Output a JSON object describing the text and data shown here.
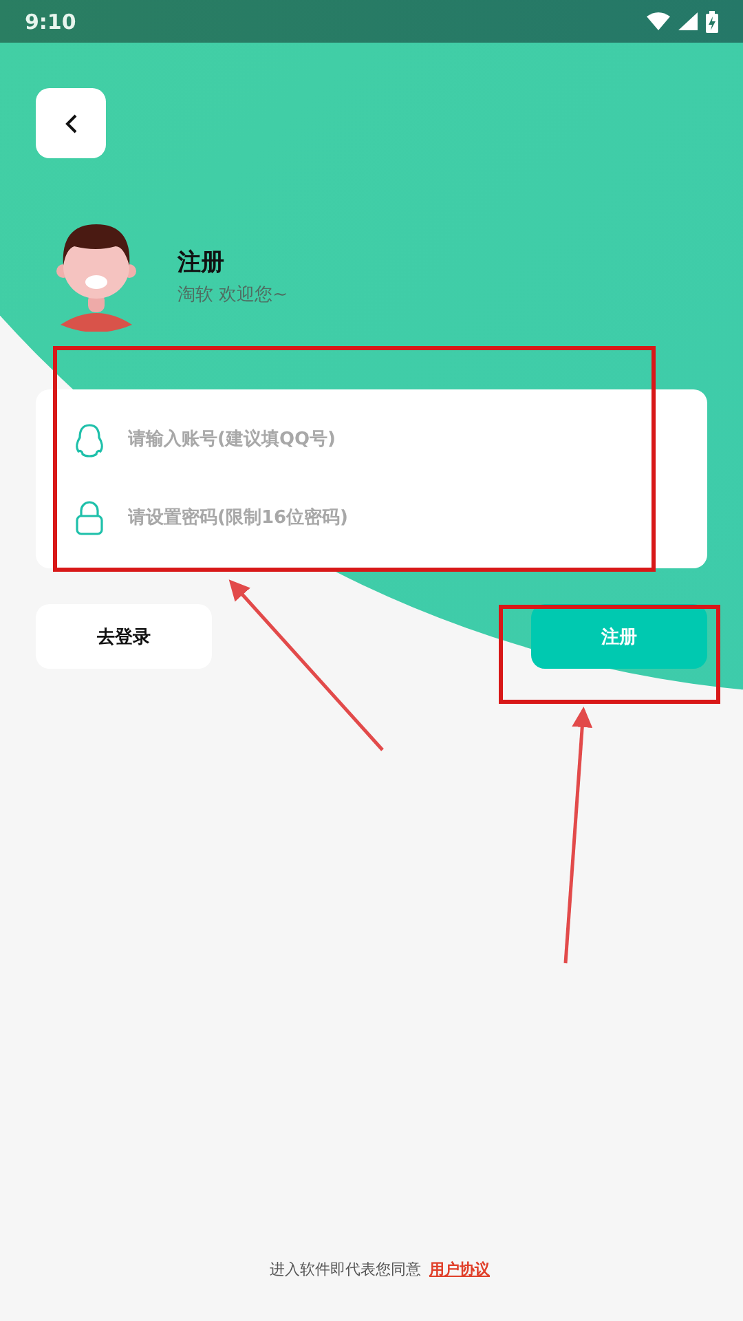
{
  "status_bar": {
    "time": "9:10"
  },
  "header": {
    "title": "注册",
    "subtitle": "淘软 欢迎您~"
  },
  "fields": [
    {
      "kind": "account",
      "placeholder": "请输入账号(建议填QQ号)"
    },
    {
      "kind": "password",
      "placeholder": "请设置密码(限制16位密码)"
    }
  ],
  "buttons": [
    {
      "kind": "secondary",
      "label": "去登录"
    },
    {
      "kind": "primary",
      "label": "注册"
    }
  ],
  "footer": {
    "text": "进入软件即代表您同意",
    "link": "用户协议"
  }
}
